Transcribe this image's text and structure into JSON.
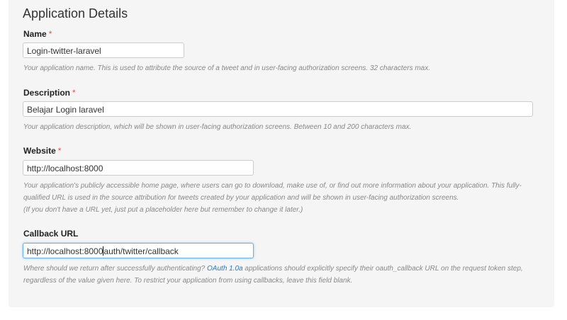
{
  "page": {
    "title": "Application Details"
  },
  "fields": {
    "name": {
      "label": "Name",
      "required_mark": "*",
      "value": "Login-twitter-laravel",
      "help": "Your application name. This is used to attribute the source of a tweet and in user-facing authorization screens. 32 characters max."
    },
    "description": {
      "label": "Description",
      "required_mark": "*",
      "value": "Belajar Login laravel",
      "help": "Your application description, which will be shown in user-facing authorization screens. Between 10 and 200 characters max."
    },
    "website": {
      "label": "Website",
      "required_mark": "*",
      "value": "http://localhost:8000",
      "help_line1": "Your application's publicly accessible home page, where users can go to download, make use of, or find out more information about your application. This fully-",
      "help_line2": "qualified URL is used in the source attribution for tweets created by your application and will be shown in user-facing authorization screens.",
      "help_line3": "(If you don't have a URL yet, just put a placeholder here but remember to change it later.)"
    },
    "callback": {
      "label": "Callback URL",
      "value_before_caret": "http://localhost:8000",
      "value_after_caret": "auth/twitter/callback",
      "help_part1": "Where should we return after successfully authenticating?",
      "help_link": "OAuth 1.0a",
      "help_part2": "applications should explicitly specify their oauth_callback URL on the request token step,",
      "help_line2": "regardless of the value given here. To restrict your application from using callbacks, leave this field blank."
    }
  }
}
